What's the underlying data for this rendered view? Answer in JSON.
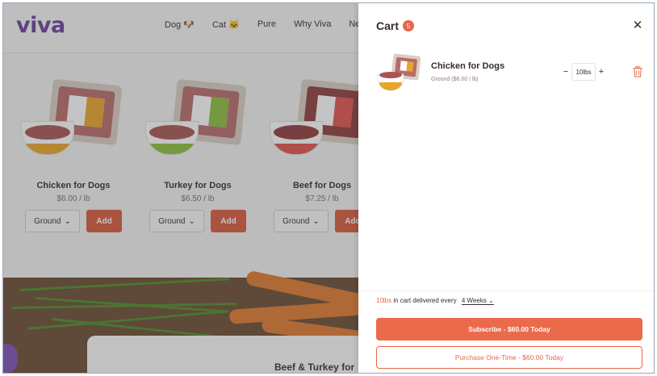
{
  "site": {
    "logo": "viva",
    "nav": [
      {
        "label": "Dog 🐶"
      },
      {
        "label": "Cat 🐱"
      },
      {
        "label": "Pure"
      },
      {
        "label": "Why Viva"
      },
      {
        "label": "New"
      }
    ]
  },
  "products": [
    {
      "name": "Chicken for Dogs",
      "price": "$6.00 / lb",
      "variant": "Ground",
      "add_label": "Add",
      "band_color": "#e8a52a",
      "label_color": "#e8a52a",
      "meat_color": "#b96a6a"
    },
    {
      "name": "Turkey for Dogs",
      "price": "$6.50 / lb",
      "variant": "Ground",
      "add_label": "Add",
      "band_color": "#8cbf3f",
      "label_color": "#8cbf3f",
      "meat_color": "#b96a6a"
    },
    {
      "name": "Beef for Dogs",
      "price": "$7.25 / lb",
      "variant": "Ground",
      "add_label": "Add",
      "band_color": "#e0524c",
      "label_color": "#e0524c",
      "meat_color": "#8e3b3b"
    }
  ],
  "promo": {
    "title": "Beef & Turkey for"
  },
  "cart": {
    "title": "Cart",
    "count": "5",
    "items": [
      {
        "name": "Chicken for Dogs",
        "variant": "Ground ($6.00 / lb)",
        "quantity": "10lbs",
        "minus": "−",
        "plus": "+"
      }
    ],
    "delivery": {
      "amount": "10lbs",
      "text": "in cart delivered every",
      "frequency": "4 Weeks"
    },
    "subscribe_label": "Subscribe - $60.00 Today",
    "onetime_label": "Purchase One-Time - $60.00 Today"
  },
  "colors": {
    "accent": "#ec6a4c",
    "brand": "#6b3fa0"
  }
}
